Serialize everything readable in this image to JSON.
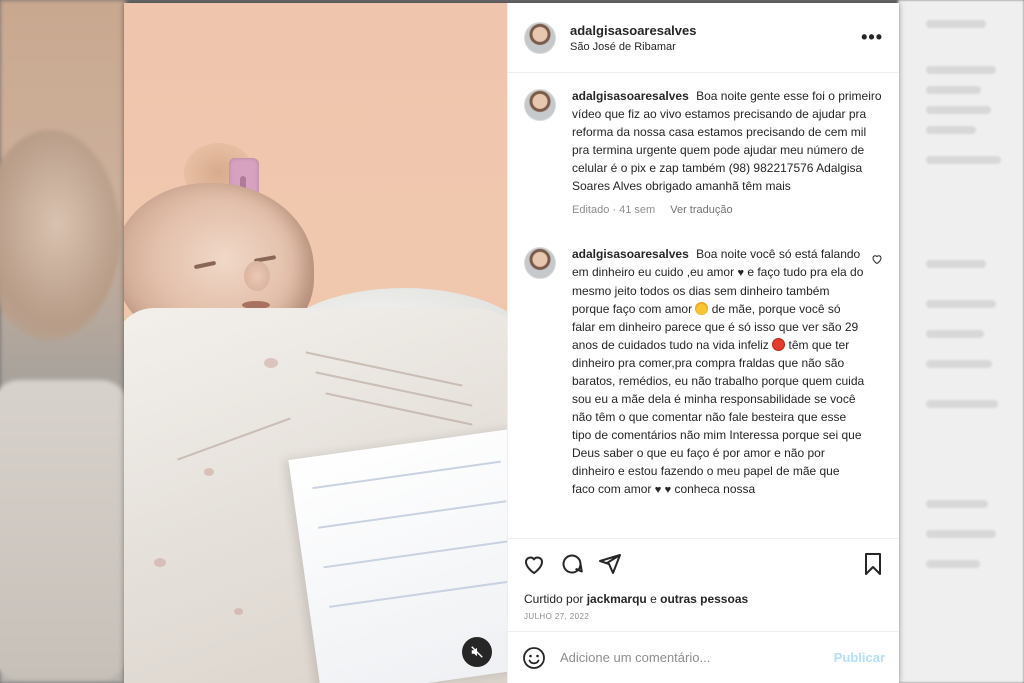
{
  "post": {
    "username": "adalgisasoaresalves",
    "location": "São José de Ribamar"
  },
  "caption": {
    "username": "adalgisasoaresalves",
    "text": "Boa noite gente esse foi o primeiro vídeo que fiz ao vivo estamos precisando de ajudar pra reforma da nossa casa estamos precisando de cem mil pra termina urgente quem pode ajudar meu número de celular é o pix e zap também (98) 982217576 Adalgisa Soares Alves obrigado amanhã têm mais",
    "edited": "Editado · 41 sem",
    "translate": "Ver tradução"
  },
  "reply": {
    "username": "adalgisasoaresalves",
    "part1": "Boa noite você só está falando em dinheiro eu cuido ,eu amor",
    "part2": "e faço tudo pra ela do mesmo jeito todos os dias sem dinheiro também porque faço com amor",
    "part3": "de mãe, porque você só falar em dinheiro parece que é só isso que ver são 29 anos de cuidados tudo na vida infeliz",
    "part4": "têm que ter dinheiro pra comer,pra compra fraldas que não são baratos, remédios, eu não trabalho porque quem cuida sou eu a mãe dela é minha responsabilidade se você não têm o que comentar não fale besteira que esse tipo de comentários não mim Interessa porque sei que Deus saber o que eu faço é por amor e não por dinheiro e estou fazendo o meu papel de mãe que faco com amor",
    "part5": "conheca nossa"
  },
  "likes": {
    "prefix": "Curtido por",
    "user": "jackmarqu",
    "mid": "e",
    "others": "outras pessoas"
  },
  "date": "JULHO 27, 2022",
  "comment_box": {
    "placeholder": "Adicione um comentário...",
    "publish_label": "Publicar"
  },
  "icons": {
    "more": "more-options-icon",
    "like": "heart-icon",
    "comment": "comment-icon",
    "share": "paper-plane-icon",
    "save": "bookmark-icon",
    "emoji": "emoji-icon",
    "mute": "muted-speaker-icon"
  },
  "colors": {
    "publish_disabled": "#b2dffc",
    "text_primary": "#262626",
    "text_secondary": "#8e8e8e"
  }
}
